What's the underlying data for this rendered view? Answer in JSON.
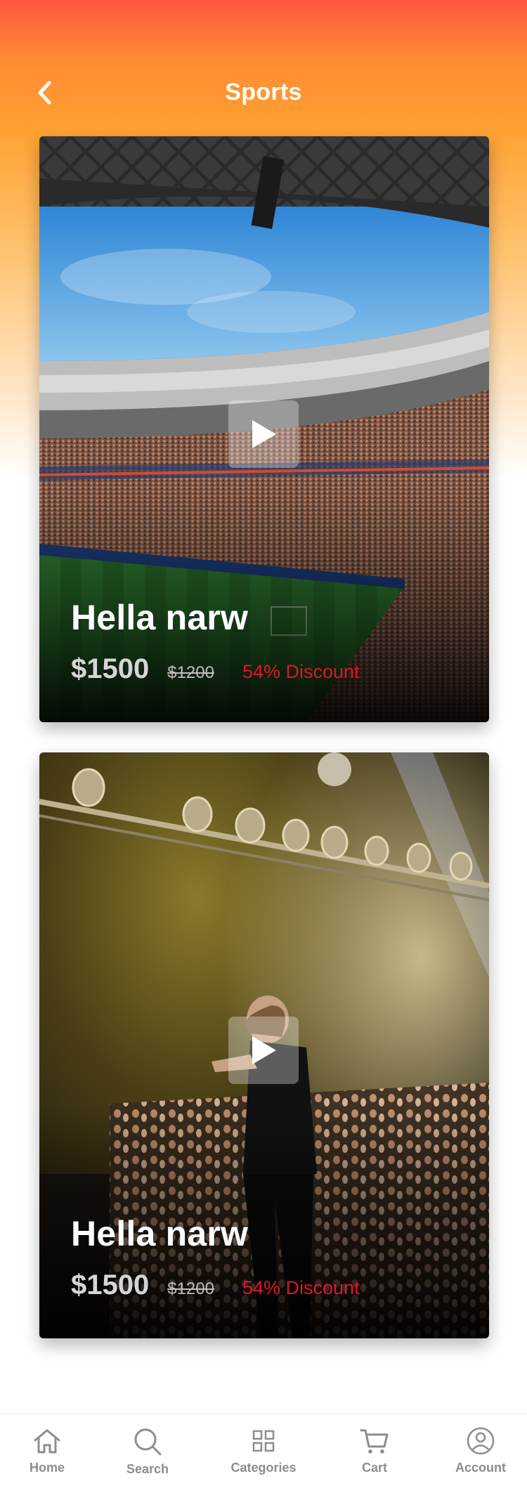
{
  "header": {
    "title": "Sports",
    "back_icon": "chevron-left-icon"
  },
  "cards": [
    {
      "image": "stadium-photo",
      "play_icon": "play-icon",
      "title": "Hella narw",
      "price": "$1500",
      "old_price": "$1200",
      "discount": "54% Discount"
    },
    {
      "image": "concert-photo",
      "play_icon": "play-icon",
      "title": "Hella narw",
      "price": "$1500",
      "old_price": "$1200",
      "discount": "54% Discount"
    }
  ],
  "bottom_nav": {
    "items": [
      {
        "label": "Home",
        "icon": "home-icon"
      },
      {
        "label": "Search",
        "icon": "search-icon"
      },
      {
        "label": "Categories",
        "icon": "grid-icon"
      },
      {
        "label": "Cart",
        "icon": "cart-icon"
      },
      {
        "label": "Account",
        "icon": "user-icon"
      }
    ]
  },
  "colors": {
    "header_gradient_top": "#ff5540",
    "header_gradient_mid": "#ffa030",
    "discount": "#e0152b",
    "nav_text": "#8d8d8d"
  }
}
